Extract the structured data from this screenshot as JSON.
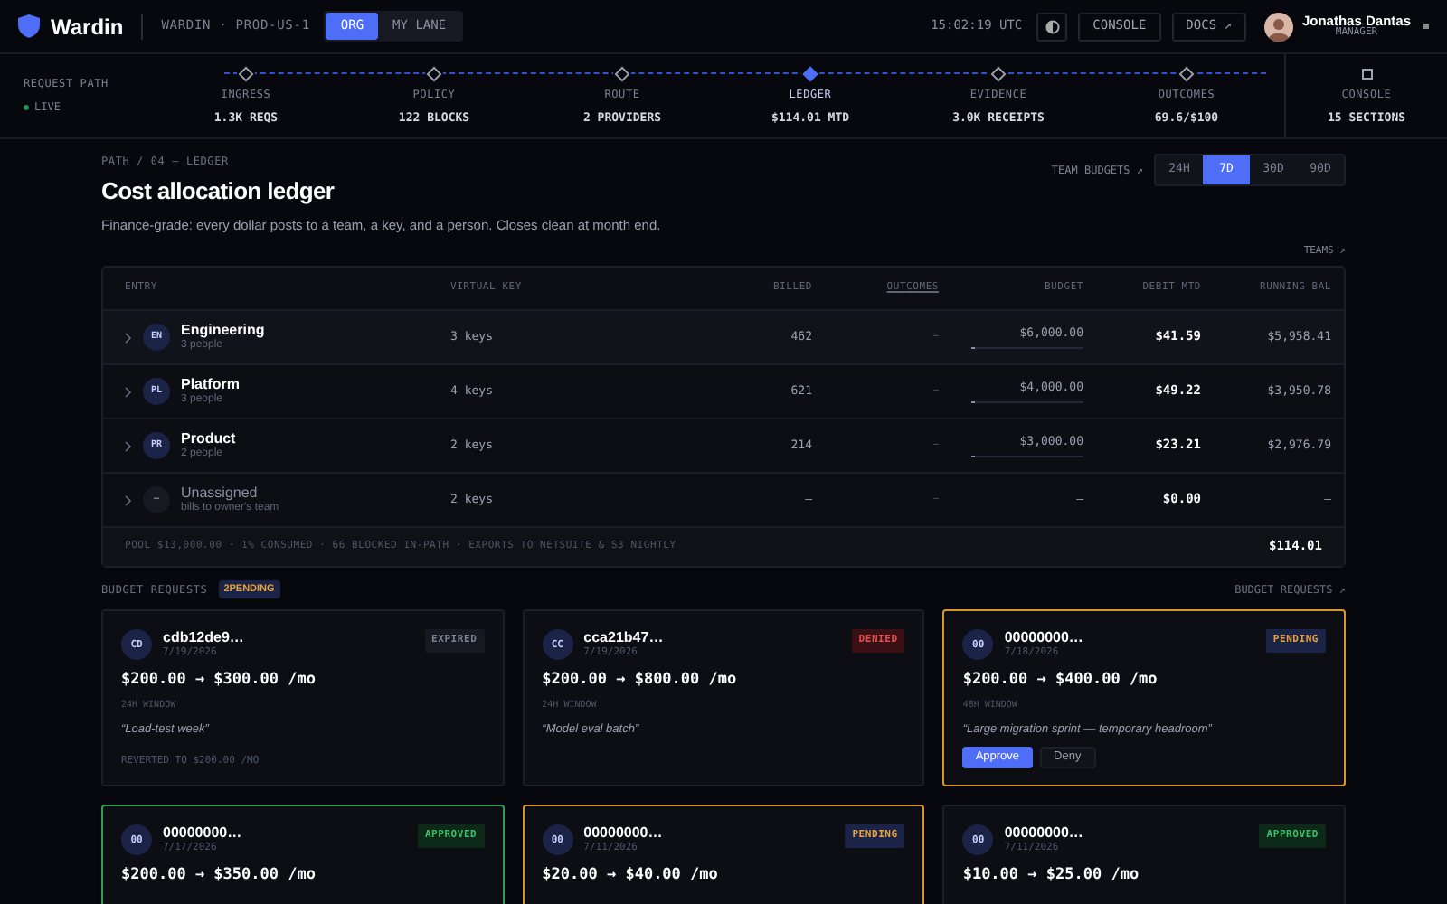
{
  "header": {
    "brand": "Wardin",
    "env": "WARDIN · PROD-US-1",
    "scopes": [
      {
        "label": "ORG",
        "selected": true
      },
      {
        "label": "MY LANE",
        "selected": false
      }
    ],
    "clock": "15:02:19 UTC",
    "buttons": [
      "CONSOLE",
      "DOCS ↗"
    ],
    "user": {
      "name": "Jonathas Dantas",
      "role": "MANAGER"
    }
  },
  "pipeline": {
    "title": "REQUEST PATH",
    "status": "LIVE",
    "stages": [
      {
        "label": "INGRESS",
        "value": "1.3K REQS",
        "selected": false,
        "kind": "step"
      },
      {
        "label": "POLICY",
        "value": "122 BLOCKS",
        "selected": false,
        "kind": "step"
      },
      {
        "label": "ROUTE",
        "value": "2 PROVIDERS",
        "selected": false,
        "kind": "step"
      },
      {
        "label": "LEDGER",
        "value": "$114.01 MTD",
        "selected": true,
        "kind": "step"
      },
      {
        "label": "EVIDENCE",
        "value": "3.0K RECEIPTS",
        "selected": false,
        "kind": "step"
      },
      {
        "label": "OUTCOMES",
        "value": "69.6/$100",
        "selected": false,
        "kind": "step"
      },
      {
        "label": "CONSOLE",
        "value": "15 SECTIONS",
        "selected": false,
        "kind": "panel"
      }
    ]
  },
  "page": {
    "breadcrumb": "PATH / 04 — LEDGER",
    "title": "Cost allocation ledger",
    "subtitle": "Finance-grade: every dollar posts to a team, a key, and a person. Closes clean at month end.",
    "budgets_link": "TEAM BUDGETS ↗",
    "ranges": [
      {
        "label": "24H",
        "selected": false
      },
      {
        "label": "7D",
        "selected": true
      },
      {
        "label": "30D",
        "selected": false
      },
      {
        "label": "90D",
        "selected": false
      }
    ],
    "teams_link": "TEAMS ↗"
  },
  "table": {
    "columns": [
      "ENTRY",
      "VIRTUAL KEY",
      "BILLED",
      "OUTCOMES",
      "BUDGET",
      "DEBIT MTD",
      "RUNNING BAL"
    ],
    "rows": [
      {
        "initials": "EN",
        "name": "Engineering",
        "sub": "3 people",
        "keys": "3 keys",
        "billed": "462",
        "outcomes": "–",
        "budget": "$6,000.00",
        "level": 0.007,
        "debit": "$41.59",
        "balance": "$5,958.41",
        "muted": false
      },
      {
        "initials": "PL",
        "name": "Platform",
        "sub": "3 people",
        "keys": "4 keys",
        "billed": "621",
        "outcomes": "–",
        "budget": "$4,000.00",
        "level": 0.012,
        "debit": "$49.22",
        "balance": "$3,950.78",
        "muted": false
      },
      {
        "initials": "PR",
        "name": "Product",
        "sub": "2 people",
        "keys": "2 keys",
        "billed": "214",
        "outcomes": "–",
        "budget": "$3,000.00",
        "level": 0.008,
        "debit": "$23.21",
        "balance": "$2,976.79",
        "muted": false
      },
      {
        "initials": "–",
        "name": "Unassigned",
        "sub": "bills to owner's team",
        "keys": "2 keys",
        "billed": "—",
        "outcomes": "–",
        "budget": "—",
        "debit": "$0.00",
        "balance": "—",
        "muted": true
      }
    ],
    "footer": "POOL $13,000.00 · 1% CONSUMED · 66 BLOCKED IN-PATH · EXPORTS TO NETSUITE & S3 NIGHTLY",
    "total": "$114.01"
  },
  "requests": {
    "title": "BUDGET REQUESTS",
    "badge": "2PENDING",
    "link": "BUDGET REQUESTS ↗",
    "cards": [
      {
        "initials": "CD",
        "id": "cdb12de9…",
        "date": "7/19/2026",
        "status": "EXPIRED",
        "highlighted": false,
        "amount": "$200.00 → $300.00 /mo",
        "window": "24H WINDOW",
        "note": "“Load-test week”",
        "footnote": "REVERTED TO $200.00 /MO"
      },
      {
        "initials": "CC",
        "id": "cca21b47…",
        "date": "7/19/2026",
        "status": "DENIED",
        "highlighted": false,
        "amount": "$200.00 → $800.00 /mo",
        "window": "24H WINDOW",
        "note": "“Model eval batch”"
      },
      {
        "initials": "00",
        "id": "00000000…",
        "date": "7/18/2026",
        "status": "PENDING",
        "highlighted": true,
        "amount": "$200.00 → $400.00 /mo",
        "window": "48H WINDOW",
        "note": "“Large migration sprint — temporary headroom”",
        "actions": [
          "Approve",
          "Deny"
        ]
      },
      {
        "initials": "00",
        "id": "00000000…",
        "date": "7/17/2026",
        "status": "APPROVED",
        "highlighted": true,
        "amount": "$200.00 → $350.00 /mo"
      },
      {
        "initials": "00",
        "id": "00000000…",
        "date": "7/11/2026",
        "status": "PENDING",
        "highlighted": true,
        "amount": "$20.00 → $40.00 /mo"
      },
      {
        "initials": "00",
        "id": "00000000…",
        "date": "7/11/2026",
        "status": "APPROVED",
        "highlighted": false,
        "amount": "$10.00 → $25.00 /mo"
      }
    ]
  }
}
